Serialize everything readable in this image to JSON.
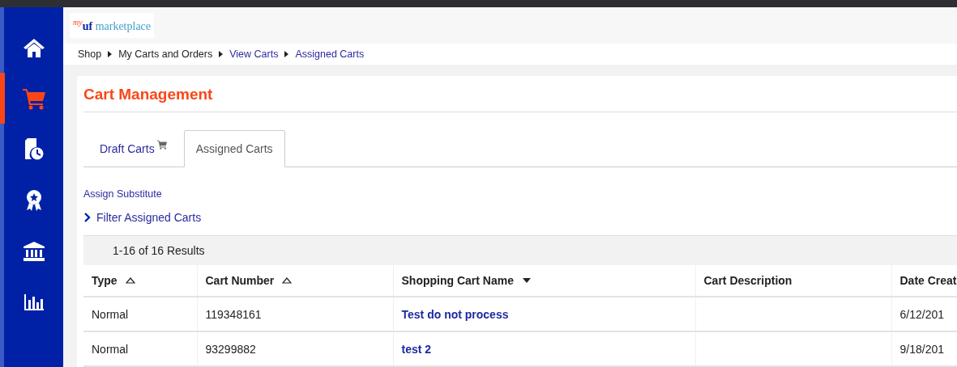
{
  "sidebar": {
    "items": [
      {
        "kind": "home",
        "selected": false
      },
      {
        "kind": "cart",
        "selected": true
      },
      {
        "kind": "docclock",
        "selected": false
      },
      {
        "kind": "award",
        "selected": false
      },
      {
        "kind": "bank",
        "selected": false
      },
      {
        "kind": "chart",
        "selected": false
      }
    ]
  },
  "logo": {
    "prefix": "my",
    "brand": "uf",
    "name": "marketplace"
  },
  "breadcrumb": [
    {
      "label": "Shop",
      "link": false
    },
    {
      "label": "My Carts and Orders",
      "link": false
    },
    {
      "label": "View Carts",
      "link": true
    },
    {
      "label": "Assigned Carts",
      "link": true
    }
  ],
  "title": "Cart Management",
  "tabs": [
    {
      "label": "Draft Carts",
      "selected": false,
      "cart_icon": true
    },
    {
      "label": "Assigned Carts",
      "selected": true,
      "cart_icon": false
    }
  ],
  "assign_link": "Assign Substitute",
  "filter": {
    "label": "Filter Assigned Carts",
    "expanded": false
  },
  "results": "1-16 of 16 Results",
  "table": {
    "columns": [
      {
        "label": "Type",
        "kind": "ascending"
      },
      {
        "label": "Cart Number",
        "kind": "ascending"
      },
      {
        "label": "Shopping Cart Name",
        "kind": "descending"
      },
      {
        "label": "Cart Description",
        "kind": "plain"
      },
      {
        "label": "Date Creat",
        "kind": "plain"
      }
    ],
    "rows": [
      {
        "type": "Normal",
        "number": "119348161",
        "name": "Test do not process",
        "date": "6/12/201"
      },
      {
        "type": "Normal",
        "number": "93299882",
        "name": "test 2",
        "date": "9/18/201"
      }
    ]
  }
}
